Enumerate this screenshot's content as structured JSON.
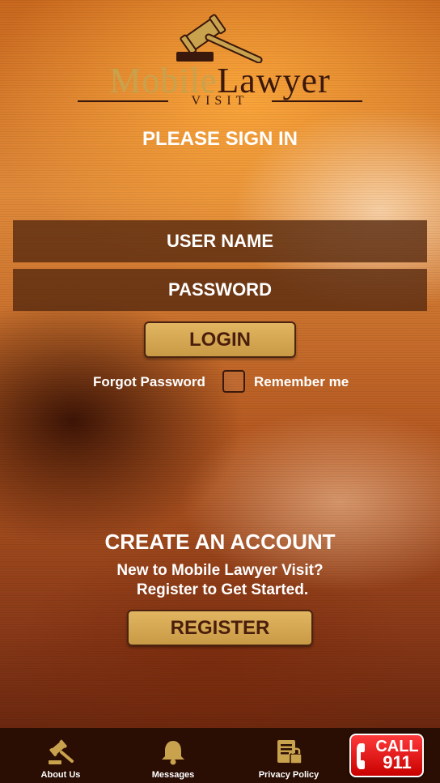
{
  "logo": {
    "word1": "Mobile",
    "word2": "Lawyer",
    "subtitle": "VISIT",
    "icon": "gavel-icon"
  },
  "signin": {
    "title": "PLEASE SIGN IN",
    "username_placeholder": "USER NAME",
    "password_placeholder": "PASSWORD",
    "login_label": "LOGIN",
    "forgot_label": "Forgot Password",
    "remember_label": "Remember me",
    "remember_checked": false
  },
  "account": {
    "title": "CREATE AN ACCOUNT",
    "line1": "New to Mobile Lawyer Visit?",
    "line2": "Register to Get Started.",
    "register_label": "REGISTER"
  },
  "nav": {
    "items": [
      {
        "label": "About Us",
        "icon": "gavel-icon"
      },
      {
        "label": "Messages",
        "icon": "bell-icon"
      },
      {
        "label": "Privacy Policy",
        "icon": "document-lock-icon"
      }
    ],
    "call": {
      "line1": "CALL",
      "line2": "911",
      "icon": "phone-icon"
    }
  },
  "colors": {
    "gold": "#c9a24e",
    "dark_brown": "#3a180c",
    "field_bg": "#54280e",
    "nav_bg": "#2a0d03",
    "call_red": "#e00000"
  }
}
